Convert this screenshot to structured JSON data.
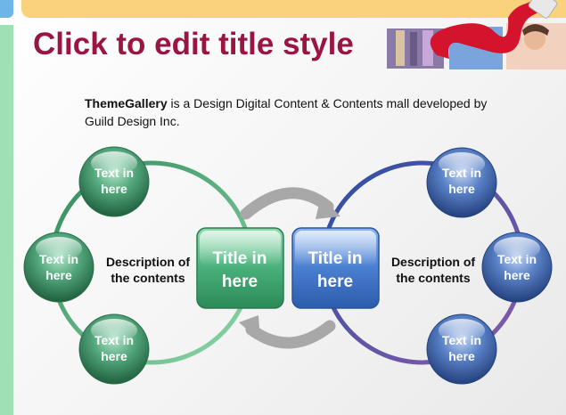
{
  "slide": {
    "title": "Click to edit title style",
    "description_brand": "ThemeGallery",
    "description_rest": " is a Design Digital Content & Contents mall developed by Guild Design Inc."
  },
  "diagram": {
    "left": {
      "circles": [
        {
          "line1": "Text in",
          "line2": "here"
        },
        {
          "line1": "Text in",
          "line2": "here"
        },
        {
          "line1": "Text in",
          "line2": "here"
        }
      ],
      "description_line1": "Description of",
      "description_line2": "the contents",
      "center_line1": "Title in",
      "center_line2": "here"
    },
    "right": {
      "circles": [
        {
          "line1": "Text in",
          "line2": "here"
        },
        {
          "line1": "Text in",
          "line2": "here"
        },
        {
          "line1": "Text in",
          "line2": "here"
        }
      ],
      "description_line1": "Description of",
      "description_line2": "the contents",
      "center_line1": "Title in",
      "center_line2": "here"
    }
  },
  "colors": {
    "title": "#9a1444",
    "green": "#3f9a6a",
    "blue": "#3a67b8",
    "arrow": "#a8a8a8"
  }
}
